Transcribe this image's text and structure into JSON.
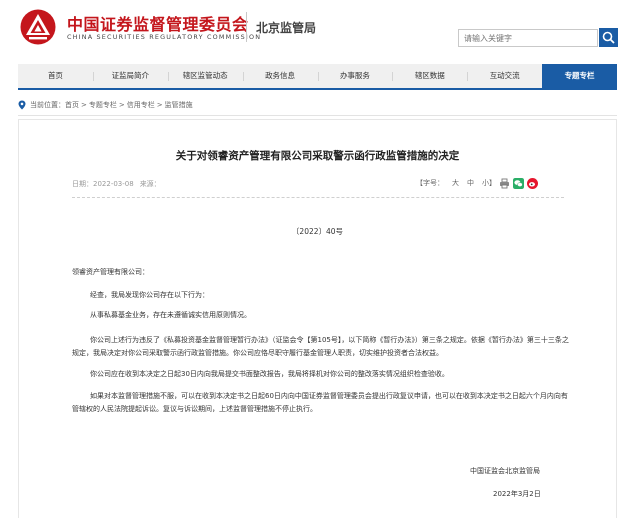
{
  "header": {
    "org_name_cn": "中国证券监督管理委员会",
    "org_name_en": "CHINA SECURITIES REGULATORY COMMISSION",
    "bureau": "北京监管局",
    "search_placeholder": "请输入关键字"
  },
  "nav": {
    "items": [
      {
        "label": "首页"
      },
      {
        "label": "证监局简介"
      },
      {
        "label": "辖区监管动态"
      },
      {
        "label": "政务信息"
      },
      {
        "label": "办事服务"
      },
      {
        "label": "辖区数据"
      },
      {
        "label": "互动交流"
      },
      {
        "label": "专题专栏"
      }
    ],
    "active_index": 7
  },
  "breadcrumb": {
    "prefix": "当前位置：",
    "items": [
      "首页",
      "专题专栏",
      "信用专栏",
      "监管措施"
    ],
    "separator": ">"
  },
  "article": {
    "title": "关于对领睿资产管理有限公司采取警示函行政监管措施的决定",
    "date_label": "日期：",
    "date": "2022-03-08",
    "source_label": "来源：",
    "source": "",
    "font_label": "【字号：",
    "font_sizes": [
      "大",
      "中",
      "小"
    ],
    "font_close": "】",
    "doc_no": "〔2022〕40号",
    "salutation": "领睿资产管理有限公司：",
    "para1": "经查，我局发现你公司存在以下行为：",
    "para2": "从事私募基金业务，存在未遵循诚实信用原则情况。",
    "para3": "你公司上述行为违反了《私募投资基金监督管理暂行办法》（证监会令【第105号】，以下简称《暂行办法》）第三条之规定。依据《暂行办法》第三十三条之规定，我局决定对你公司采取警示函行政监管措施。你公司应恪尽职守履行基金管理人职责，切实维护投资者合法权益。",
    "para4": "你公司应在收到本决定之日起30日内向我局提交书面整改报告，我局将择机对你公司的整改落实情况组织检查验收。",
    "para5": "如果对本监督管理措施不服，可以在收到本决定书之日起60日内向中国证券监督管理委员会提出行政复议申请，也可以在收到本决定书之日起六个月内向有管辖权的人民法院提起诉讼。复议与诉讼期间，上述监督管理措施不停止执行。",
    "signature": "中国证监会北京监管局",
    "sign_date": "2022年3月2日"
  },
  "colors": {
    "brand_red": "#c4161c",
    "nav_blue": "#1a5ca5",
    "wechat_green": "#2aae67",
    "weibo_red": "#e6162d"
  }
}
